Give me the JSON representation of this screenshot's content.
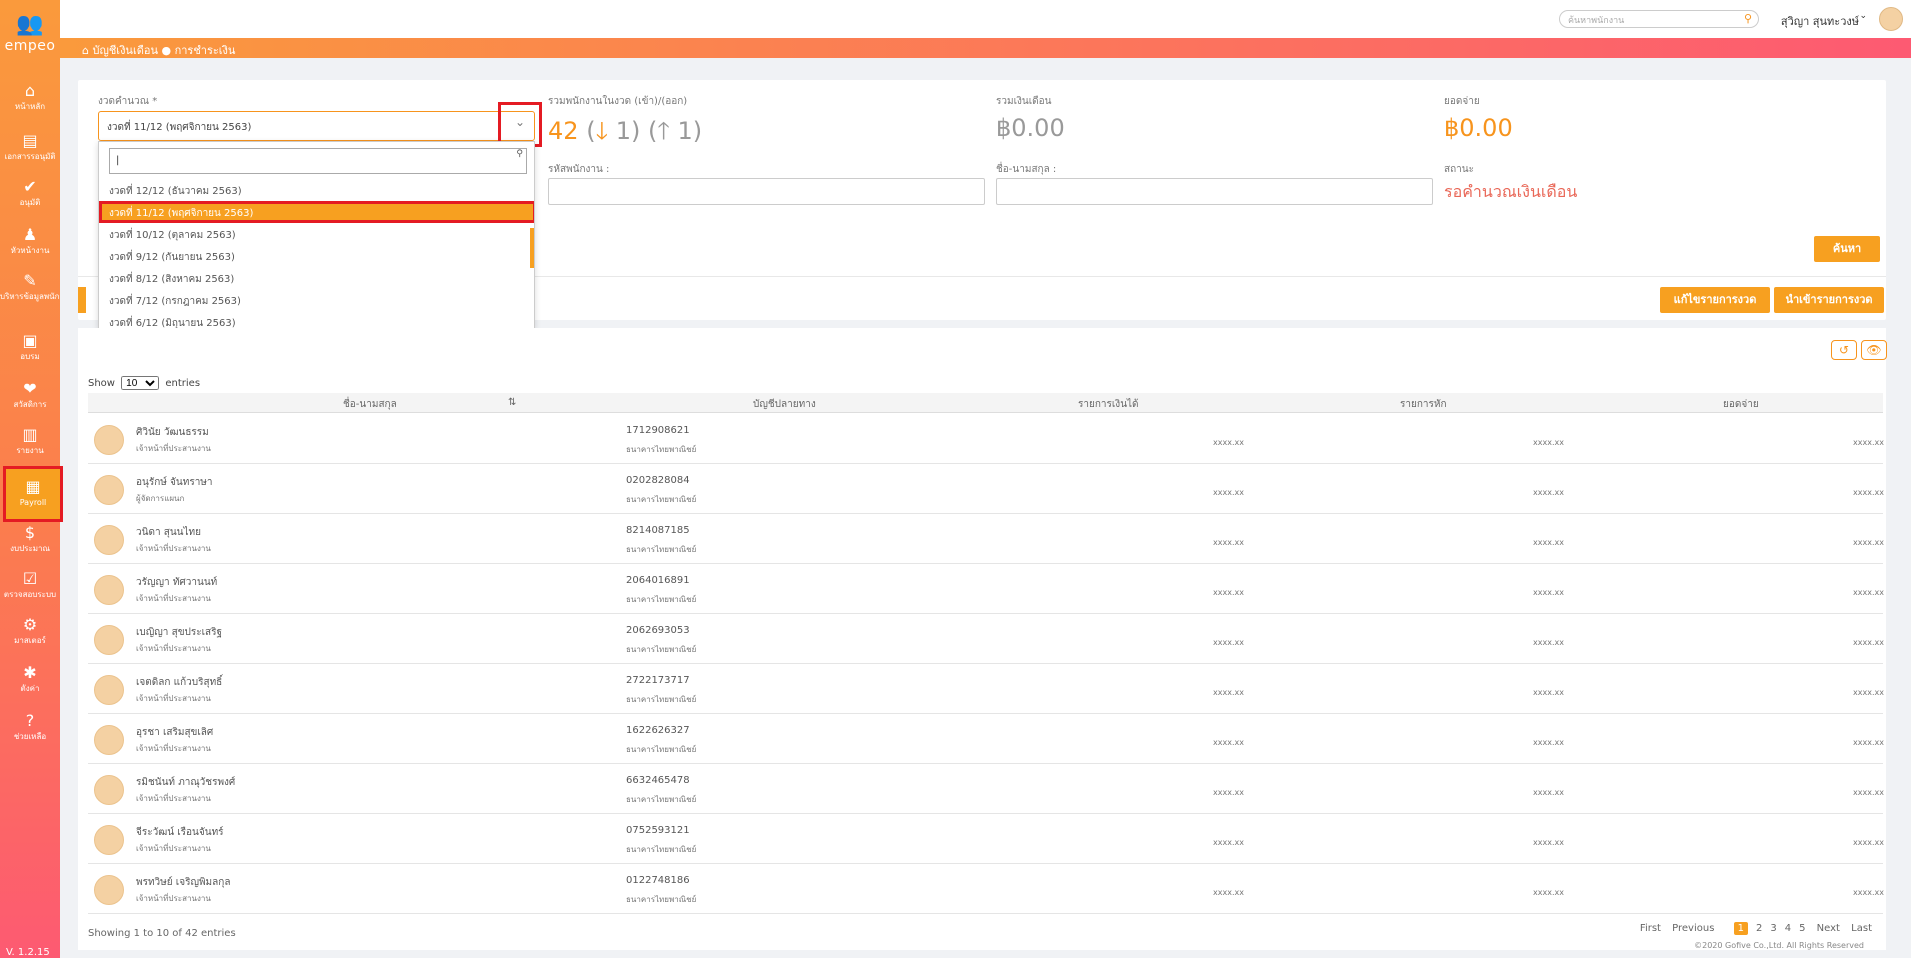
{
  "app": {
    "logo_text": "empeo",
    "version": "V. 1.2.15"
  },
  "sidebar": {
    "items": [
      {
        "icon": "⌂",
        "label": "หน้าหลัก"
      },
      {
        "icon": "▤",
        "label": "เอกสารรอนุมัติ"
      },
      {
        "icon": "✔",
        "label": "อนุมัติ"
      },
      {
        "icon": "♟",
        "label": "หัวหน้างาน"
      },
      {
        "icon": "✎",
        "label": "บริหารข้อมูลพนักงาน"
      },
      {
        "icon": "▣",
        "label": "อบรม"
      },
      {
        "icon": "❤",
        "label": "สวัสดิการ"
      },
      {
        "icon": "▥",
        "label": "รายงาน"
      },
      {
        "icon": "▦",
        "label": "Payroll"
      },
      {
        "icon": "$",
        "label": "งบประมาณ"
      },
      {
        "icon": "☑",
        "label": "ตรวจสอบระบบ"
      },
      {
        "icon": "⚙",
        "label": "มาสเตอร์"
      },
      {
        "icon": "✱",
        "label": "ตั้งค่า"
      },
      {
        "icon": "?",
        "label": "ช่วยเหลือ"
      }
    ]
  },
  "topbar": {
    "search_placeholder": "ค้นหาพนักงาน",
    "user_name": "สุวิญา สุนทะวงษ์"
  },
  "breadcrumb": {
    "text": "บัญชีเงินเดือน ● การชำระเงิน"
  },
  "filter": {
    "period_label": "งวดคำนวณ *",
    "period_value": "งวดที่ 11/12 (พฤศจิกายน 2563)",
    "employees_label": "รวมพนักงานในงวด (เข้า)/(ออก)",
    "employees_total": "42",
    "employees_in": "1",
    "employees_out": "1",
    "salary_label": "รวมเงินเดือน",
    "salary_value": "฿0.00",
    "payout_label": "ยอดจ่าย",
    "payout_value": "฿0.00",
    "emp_code_label": "รหัสพนักงาน :",
    "name_label": "ชื่อ-นามสกุล :",
    "status_label": "สถานะ",
    "status_value": "รอคำนวณเงินเดือน",
    "search_button": "ค้นหา",
    "edit_period_button": "แก้ไขรายการงวด",
    "import_period_button": "นำเข้ารายการงวด"
  },
  "dropdown": {
    "options": [
      "งวดที่ 12/12 (ธันวาคม 2563)",
      "งวดที่ 11/12 (พฤศจิกายน 2563)",
      "งวดที่ 10/12 (ตุลาคม 2563)",
      "งวดที่ 9/12 (กันยายน 2563)",
      "งวดที่ 8/12 (สิงหาคม 2563)",
      "งวดที่ 7/12 (กรกฎาคม 2563)",
      "งวดที่ 6/12 (มิถุนายน 2563)"
    ],
    "selected_index": 1
  },
  "table": {
    "show_label": "Show",
    "entries_label": "entries",
    "page_size": "10",
    "columns": [
      "ชื่อ-นามสกุล",
      "บัญชีปลายทาง",
      "รายการเงินได้",
      "รายการหัก",
      "ยอดจ่าย"
    ],
    "rows": [
      {
        "name": "ศิวินัย วัฒนธรรม",
        "position": "เจ้าหน้าที่ประสานงาน",
        "account": "1712908621",
        "bank": "ธนาคารไทยพาณิชย์",
        "income": "xxxx.xx",
        "deduction": "xxxx.xx",
        "pay": "xxxx.xx"
      },
      {
        "name": "อนุรักษ์ จันทราษา",
        "position": "ผู้จัดการแผนก",
        "account": "0202828084",
        "bank": "ธนาคารไทยพาณิชย์",
        "income": "xxxx.xx",
        "deduction": "xxxx.xx",
        "pay": "xxxx.xx"
      },
      {
        "name": "วนิดา สุนนไทย",
        "position": "เจ้าหน้าที่ประสานงาน",
        "account": "8214087185",
        "bank": "ธนาคารไทยพาณิชย์",
        "income": "xxxx.xx",
        "deduction": "xxxx.xx",
        "pay": "xxxx.xx"
      },
      {
        "name": "วรัญญา ทัศวานนท์",
        "position": "เจ้าหน้าที่ประสานงาน",
        "account": "2064016891",
        "bank": "ธนาคารไทยพาณิชย์",
        "income": "xxxx.xx",
        "deduction": "xxxx.xx",
        "pay": "xxxx.xx"
      },
      {
        "name": "เบญิญา สุขประเสริฐ",
        "position": "เจ้าหน้าที่ประสานงาน",
        "account": "2062693053",
        "bank": "ธนาคารไทยพาณิชย์",
        "income": "xxxx.xx",
        "deduction": "xxxx.xx",
        "pay": "xxxx.xx"
      },
      {
        "name": "เจตดิลก แก้วบริสุทธิ์",
        "position": "เจ้าหน้าที่ประสานงาน",
        "account": "2722173717",
        "bank": "ธนาคารไทยพาณิชย์",
        "income": "xxxx.xx",
        "deduction": "xxxx.xx",
        "pay": "xxxx.xx"
      },
      {
        "name": "อุรชา เสริมสุขเลิศ",
        "position": "เจ้าหน้าที่ประสานงาน",
        "account": "1622626327",
        "bank": "ธนาคารไทยพาณิชย์",
        "income": "xxxx.xx",
        "deduction": "xxxx.xx",
        "pay": "xxxx.xx"
      },
      {
        "name": "รมิชนันท์ ภาณุวัชรพงศ์",
        "position": "เจ้าหน้าที่ประสานงาน",
        "account": "6632465478",
        "bank": "ธนาคารไทยพาณิชย์",
        "income": "xxxx.xx",
        "deduction": "xxxx.xx",
        "pay": "xxxx.xx"
      },
      {
        "name": "จีระวัฒน์ เรือนจันทร์",
        "position": "เจ้าหน้าที่ประสานงาน",
        "account": "0752593121",
        "bank": "ธนาคารไทยพาณิชย์",
        "income": "xxxx.xx",
        "deduction": "xxxx.xx",
        "pay": "xxxx.xx"
      },
      {
        "name": "พรทวิษย์ เจริญพิมลกุล",
        "position": "เจ้าหน้าที่ประสานงาน",
        "account": "0122748186",
        "bank": "ธนาคารไทยพาณิชย์",
        "income": "xxxx.xx",
        "deduction": "xxxx.xx",
        "pay": "xxxx.xx"
      }
    ],
    "showing_text": "Showing 1 to 10 of 42 entries",
    "pager": {
      "first": "First",
      "previous": "Previous",
      "pages": [
        "1",
        "2",
        "3",
        "4",
        "5"
      ],
      "current": "1",
      "next": "Next",
      "last": "Last"
    }
  },
  "footer": {
    "copyright": "©2020 Gofive Co.,Ltd. All Rights Reserved"
  },
  "colors": {
    "accent": "#f7a020",
    "highlight": "#e41b23",
    "status": "#e96757"
  }
}
